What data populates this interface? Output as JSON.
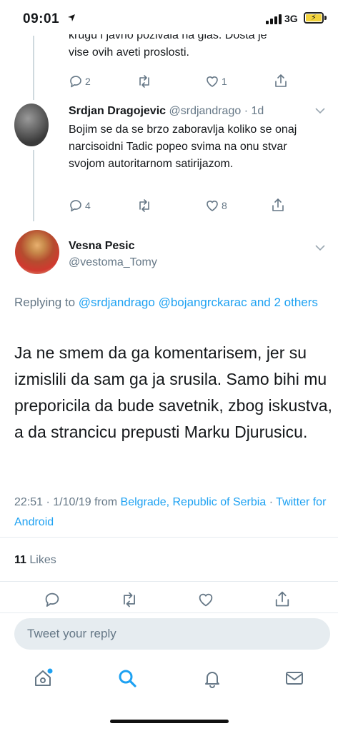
{
  "status": {
    "time": "09:01",
    "network": "3G",
    "location_icon": "location-arrow-icon",
    "battery_icon": "battery-charging-icon"
  },
  "top_tweet": {
    "text_partial": "krugu i javno pozivala na glas. Dosta je",
    "text_line2": "vise ovih aveti proslosti.",
    "reply_count": "2",
    "retweet_count": "",
    "like_count": "1"
  },
  "tweet_srdjan": {
    "name": "Srdjan Dragojevic",
    "handle": "@srdjandrago",
    "time": "1d",
    "text": "Bojim se da se brzo zaboravlja koliko se onaj narcisoidni Tadic popeo svima na onu stvar svojom autoritarnom satirijazom.",
    "reply_count": "4",
    "retweet_count": "",
    "like_count": "8"
  },
  "main_tweet": {
    "name": "Vesna Pesic",
    "handle": "@vestoma_Tomy",
    "replying_prefix": "Replying to",
    "replying_to_1": "@srdjandrago",
    "replying_to_2": "@bojangrckarac",
    "replying_and": "and",
    "replying_others": "2 others",
    "text": "Ja ne smem da ga komentarisem, jer su izmislili da sam ga ja srusila. Samo bihi mu preporicila da bude savetnik, zbog iskustva, a da strancicu prepusti Marku Djurusicu.",
    "timestamp": "22:51 · 1/10/19 from",
    "location": "Belgrade, Republic of Serbia",
    "source": "Twitter for Android",
    "likes_count": "11",
    "likes_label": "Likes"
  },
  "reply_box": {
    "placeholder": "Tweet your reply"
  },
  "tabs": [
    "home",
    "search",
    "notifications",
    "messages"
  ],
  "colors": {
    "accent": "#1da1f2",
    "secondary_text": "#657786",
    "notification_dot": "#1da1f2"
  }
}
